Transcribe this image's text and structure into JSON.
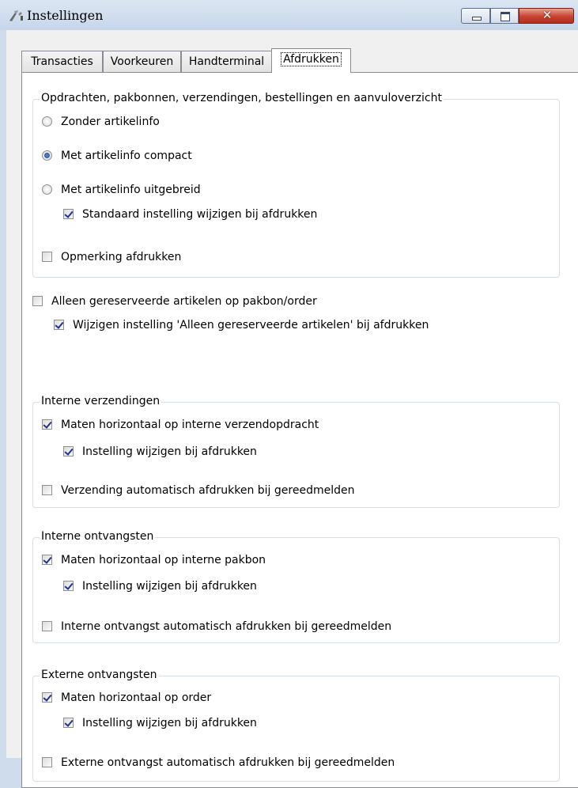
{
  "window": {
    "title": "Instellingen",
    "close_symbol": "✕",
    "icon": "tools-icon"
  },
  "tabs": [
    {
      "label": "Transacties",
      "selected": false
    },
    {
      "label": "Voorkeuren",
      "selected": false
    },
    {
      "label": "Handterminal",
      "selected": false
    },
    {
      "label": "Afdrukken",
      "selected": true
    }
  ],
  "group_orders": {
    "title": "Opdrachten, pakbonnen, verzendingen, bestellingen en aanvuloverzicht",
    "radio_without": {
      "label": "Zonder artikelinfo",
      "checked": false
    },
    "radio_compact": {
      "label": "Met artikelinfo compact",
      "checked": true
    },
    "radio_extended": {
      "label": "Met artikelinfo uitgebreid",
      "checked": false
    },
    "check_default_change": {
      "label": "Standaard instelling wijzigen bij afdrukken",
      "checked": true
    },
    "check_remark": {
      "label": "Opmerking afdrukken",
      "checked": false
    }
  },
  "reserved": {
    "check_only_reserved": {
      "label": "Alleen gereserveerde artikelen op pakbon/order",
      "checked": false
    },
    "check_change_reserved": {
      "label": "Wijzigen instelling 'Alleen gereserveerde artikelen' bij afdrukken",
      "checked": true
    }
  },
  "group_internal_shipments": {
    "title": "Interne verzendingen",
    "check_sizes": {
      "label": "Maten horizontaal op interne verzendopdracht",
      "checked": true
    },
    "check_change": {
      "label": "Instelling wijzigen bij afdrukken",
      "checked": true
    },
    "check_auto": {
      "label": "Verzending automatisch afdrukken bij gereedmelden",
      "checked": false
    }
  },
  "group_internal_receipts": {
    "title": "Interne ontvangsten",
    "check_sizes": {
      "label": "Maten horizontaal op interne pakbon",
      "checked": true
    },
    "check_change": {
      "label": "Instelling wijzigen bij afdrukken",
      "checked": true
    },
    "check_auto": {
      "label": "Interne ontvangst automatisch afdrukken bij gereedmelden",
      "checked": false
    }
  },
  "group_external_receipts": {
    "title": "Externe ontvangsten",
    "check_sizes": {
      "label": "Maten horizontaal op order",
      "checked": true
    },
    "check_change": {
      "label": "Instelling wijzigen bij afdrukken",
      "checked": true
    },
    "check_auto": {
      "label": "Externe ontvangst automatisch afdrukken bij gereedmelden",
      "checked": false
    }
  }
}
